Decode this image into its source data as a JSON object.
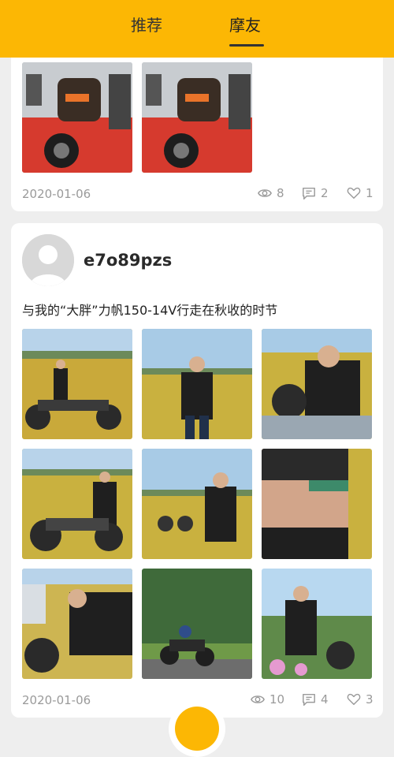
{
  "tabs": {
    "recommend": "推荐",
    "friends": "摩友"
  },
  "post1": {
    "date": "2020-01-06",
    "views": "8",
    "comments": "2",
    "likes": "1"
  },
  "post2": {
    "username": "e7o89pzs",
    "text": "与我的“大胖”力帆150-14V行走在秋收的时节",
    "date": "2020-01-06",
    "views": "10",
    "comments": "4",
    "likes": "3"
  },
  "colors": {
    "accent": "#fcb704",
    "muted_text": "#9a9a9a"
  },
  "icons": {
    "views": "eye-icon",
    "comments": "comment-icon",
    "likes": "heart-icon"
  }
}
